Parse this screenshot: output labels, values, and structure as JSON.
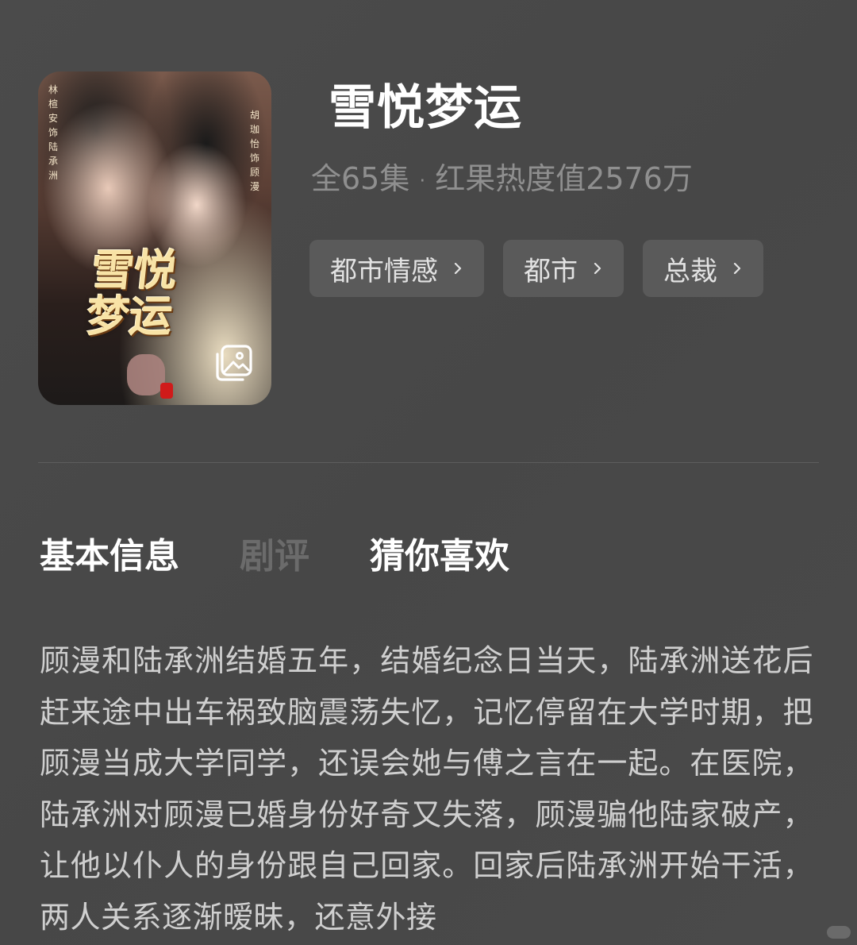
{
  "poster": {
    "side_text_left": "林楦安饰陆承洲",
    "side_text_right": "胡珈怡饰顾漫",
    "title_art": "雪悦梦运",
    "gallery_icon": "image-gallery-icon"
  },
  "drama": {
    "title": "雪悦梦运",
    "episodes": "全65集",
    "separator": "·",
    "heat": "红果热度值2576万"
  },
  "tags": [
    {
      "label": "都市情感"
    },
    {
      "label": "都市"
    },
    {
      "label": "总裁"
    }
  ],
  "tabs": [
    {
      "label": "基本信息",
      "active": true
    },
    {
      "label": "剧评",
      "active": false
    },
    {
      "label": "猜你喜欢",
      "active": true
    }
  ],
  "description": "顾漫和陆承洲结婚五年，结婚纪念日当天，陆承洲送花后赶来途中出车祸致脑震荡失忆，记忆停留在大学时期，把顾漫当成大学同学，还误会她与傅之言在一起。在医院，陆承洲对顾漫已婚身份好奇又失落，顾漫骗他陆家破产，让他以仆人的身份跟自己回家。回家后陆承洲开始干活，两人关系逐渐暧昧，还意外接",
  "colors": {
    "background": "#4a4a4a",
    "tag_background": "#5a5a5a",
    "meta_text": "#8f8f8f",
    "description_text": "#cfcfcf"
  }
}
